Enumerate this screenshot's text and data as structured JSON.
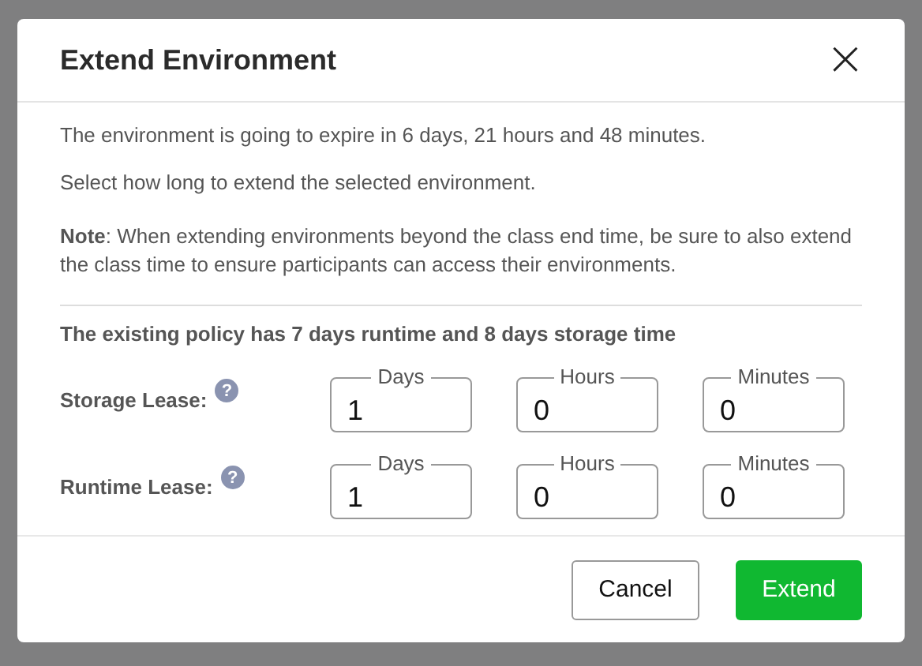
{
  "dialog": {
    "title": "Extend Environment",
    "close_symbol": "×"
  },
  "messages": [
    "The environment is going to expire in 6 days, 21 hours and 48 minutes.",
    "Select how long to extend the selected environment.",
    "**Note**: When extending environments beyond the class end time, be sure to also extend the class time to ensure participants can access their environments."
  ],
  "policy": "The existing policy has 7 days runtime and 8 days storage time",
  "leases": [
    {
      "label": "Storage Lease:",
      "help": "?",
      "fields": [
        {
          "label": "Days",
          "value": "1"
        },
        {
          "label": "Hours",
          "value": "0"
        },
        {
          "label": "Minutes",
          "value": "0"
        }
      ]
    },
    {
      "label": "Runtime Lease:",
      "help": "?",
      "fields": [
        {
          "label": "Days",
          "value": "1"
        },
        {
          "label": "Hours",
          "value": "0"
        },
        {
          "label": "Minutes",
          "value": "0"
        }
      ]
    }
  ],
  "buttons": [
    {
      "label": "Cancel",
      "kind": "secondary"
    },
    {
      "label": "Extend",
      "kind": "primary"
    }
  ]
}
